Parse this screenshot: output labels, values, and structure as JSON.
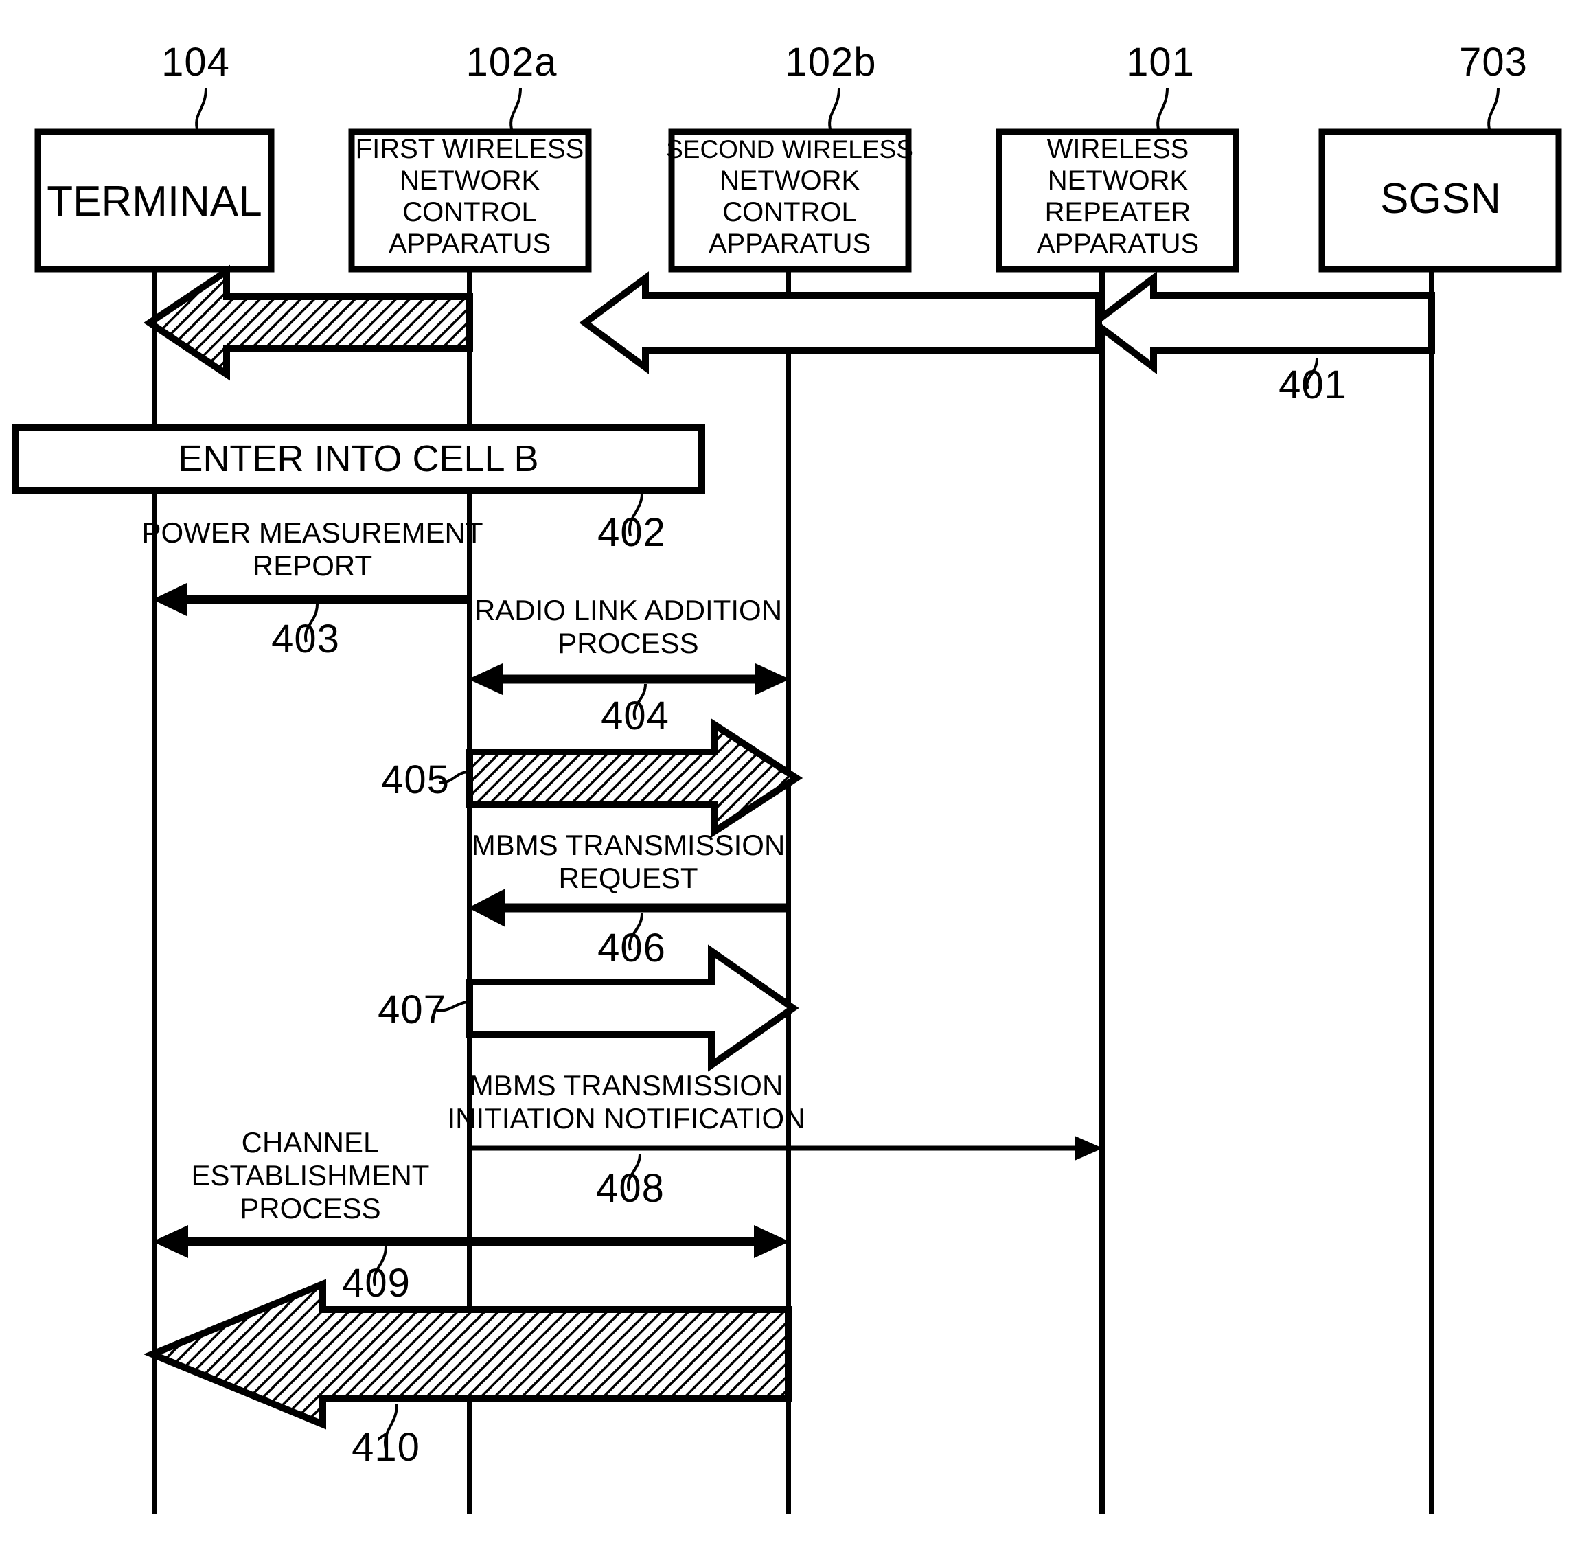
{
  "figure": {
    "type": "sequence-diagram",
    "title": "",
    "background": "#ffffff",
    "ink": "#000000"
  },
  "nodes": [
    {
      "id": "terminal",
      "ref": "104",
      "lines": [
        "TERMINAL"
      ]
    },
    {
      "id": "rnc-first",
      "ref": "102a",
      "lines": [
        "FIRST WIRELESS",
        "NETWORK",
        "CONTROL",
        "APPARATUS"
      ]
    },
    {
      "id": "rnc-second",
      "ref": "102b",
      "lines": [
        "SECOND WIRELESS",
        "NETWORK",
        "CONTROL",
        "APPARATUS"
      ]
    },
    {
      "id": "repeater",
      "ref": "101",
      "lines": [
        "WIRELESS",
        "NETWORK",
        "REPEATER",
        "APPARATUS"
      ]
    },
    {
      "id": "sgsn",
      "ref": "703",
      "lines": [
        "SGSN"
      ]
    }
  ],
  "steps": [
    {
      "ref": "401",
      "label": "",
      "from": "sgsn",
      "to": "terminal",
      "style": "hollow-then-hatched-broadband"
    },
    {
      "ref": "402",
      "label": "ENTER INTO CELL B",
      "style": "span-box"
    },
    {
      "ref": "403",
      "label": "POWER MEASUREMENT\nREPORT",
      "label_lines": [
        "POWER MEASUREMENT",
        "REPORT"
      ],
      "from": "rnc-first",
      "to": "terminal",
      "style": "solid-arrow-left"
    },
    {
      "ref": "404",
      "label_lines": [
        "RADIO LINK ADDITION",
        "PROCESS"
      ],
      "from": "rnc-first",
      "to": "rnc-second",
      "style": "double-headed-arrow"
    },
    {
      "ref": "405",
      "label_lines": [],
      "from": "rnc-first",
      "to": "rnc-second",
      "style": "hatched-broad-arrow-right"
    },
    {
      "ref": "406",
      "label_lines": [
        "MBMS TRANSMISSION",
        "REQUEST"
      ],
      "from": "rnc-second",
      "to": "rnc-first",
      "style": "solid-arrow-left"
    },
    {
      "ref": "407",
      "label_lines": [],
      "from": "rnc-first",
      "to": "rnc-second",
      "style": "hollow-broad-arrow-right"
    },
    {
      "ref": "408",
      "label_lines": [
        "MBMS TRANSMISSION",
        "INITIATION NOTIFICATION"
      ],
      "from": "rnc-first",
      "to": "repeater",
      "style": "thin-arrow-right"
    },
    {
      "ref": "409",
      "label_lines": [
        "CHANNEL",
        "ESTABLISHMENT",
        "PROCESS"
      ],
      "from": "terminal",
      "to": "rnc-second",
      "style": "double-headed-arrow"
    },
    {
      "ref": "410",
      "label_lines": [],
      "from": "rnc-second",
      "to": "terminal",
      "style": "hatched-broad-arrow-left"
    }
  ],
  "labels": {
    "ref_104": "104",
    "ref_102a": "102a",
    "ref_102b": "102b",
    "ref_101": "101",
    "ref_703": "703",
    "ref_401": "401",
    "ref_402": "402",
    "ref_403": "403",
    "ref_404": "404",
    "ref_405": "405",
    "ref_406": "406",
    "ref_407": "407",
    "ref_408": "408",
    "ref_409": "409",
    "ref_410": "410",
    "terminal_l1": "TERMINAL",
    "rnc1_l1": "FIRST WIRELESS",
    "rnc1_l2": "NETWORK",
    "rnc1_l3": "CONTROL",
    "rnc1_l4": "APPARATUS",
    "rnc2_l1": "SECOND WIRELESS",
    "rnc2_l2": "NETWORK",
    "rnc2_l3": "CONTROL",
    "rnc2_l4": "APPARATUS",
    "rep_l1": "WIRELESS",
    "rep_l2": "NETWORK",
    "rep_l3": "REPEATER",
    "rep_l4": "APPARATUS",
    "sgsn_l1": "SGSN",
    "cellb": "ENTER INTO CELL B",
    "pmr_l1": "POWER MEASUREMENT",
    "pmr_l2": "REPORT",
    "rla_l1": "RADIO LINK ADDITION",
    "rla_l2": "PROCESS",
    "mtr_l1": "MBMS TRANSMISSION",
    "mtr_l2": "REQUEST",
    "mtin_l1": "MBMS TRANSMISSION",
    "mtin_l2": "INITIATION NOTIFICATION",
    "cep_l1": "CHANNEL",
    "cep_l2": "ESTABLISHMENT",
    "cep_l3": "PROCESS"
  }
}
